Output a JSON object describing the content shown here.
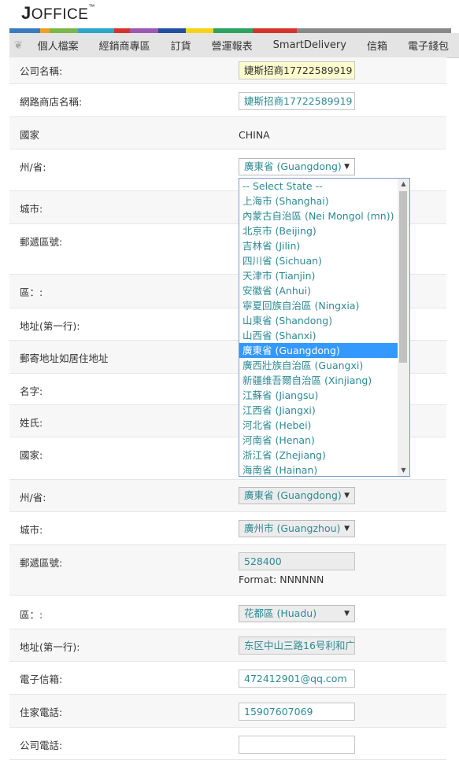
{
  "header": {
    "logo_first": "J",
    "logo_rest": "OFFICE",
    "logo_tm": "™",
    "stripe_colors": [
      "#3a7bbf",
      "#f0a020",
      "#7ab648",
      "#2aa6c9",
      "#d6332a",
      "#9b59b6",
      "#1f4f9e",
      "#f7d21a",
      "#2ca25f",
      "#d6332a",
      "#888888"
    ]
  },
  "nav": {
    "items": [
      "個人檔案",
      "經銷商專區",
      "訂貨",
      "營運報表",
      "SmartDelivery",
      "信箱",
      "電子錢包"
    ]
  },
  "form": {
    "company_name": {
      "label": "公司名稱:",
      "value": "婕斯招商17722589919"
    },
    "shop_name": {
      "label": "網路商店名稱:",
      "value": "婕斯招商17722589919"
    },
    "country": {
      "label": "國家",
      "value": "CHINA"
    },
    "state": {
      "label": "州/省:",
      "value": "廣東省 (Guangdong)"
    },
    "city": {
      "label": "城市:"
    },
    "postal": {
      "label": "郵遞區號:"
    },
    "district": {
      "label": "區：:"
    },
    "address1": {
      "label": "地址(第一行):"
    },
    "mailing": {
      "label": "郵寄地址如居住地址"
    },
    "first_name": {
      "label": "名字:"
    },
    "last_name": {
      "label": "姓氏:"
    },
    "country2": {
      "label": "國家:"
    },
    "state2": {
      "label": "州/省:",
      "value": "廣東省 (Guangdong)"
    },
    "city2": {
      "label": "城市:",
      "value": "廣州市 (Guangzhou)"
    },
    "postal2": {
      "label": "郵遞區號:",
      "value": "528400",
      "hint": "Format: NNNNNN"
    },
    "district2": {
      "label": "區：:",
      "value": "花都區 (Huadu)"
    },
    "address1_2": {
      "label": "地址(第一行):",
      "value": "东区中山三路16号利和广"
    },
    "email": {
      "label": "電子信箱:",
      "value": "472412901@qq.com"
    },
    "home_phone": {
      "label": "住家電話:",
      "value": "15907607069"
    },
    "company_phone": {
      "label": "公司電話:",
      "value": ""
    }
  },
  "dropdown": {
    "options": [
      "-- Select State --",
      "上海市 (Shanghai)",
      "內蒙古自治區 (Nei Mongol (mn))",
      "北京市 (Beijing)",
      "吉林省 (Jilin)",
      "四川省 (Sichuan)",
      "天津市 (Tianjin)",
      "安徽省 (Anhui)",
      "寧夏回族自治區 (Ningxia)",
      "山東省 (Shandong)",
      "山西省 (Shanxi)",
      "廣東省 (Guangdong)",
      "廣西壯族自治區 (Guangxi)",
      "新疆维吾爾自治區 (Xinjiang)",
      "江蘇省 (Jiangsu)",
      "江西省 (Jiangxi)",
      "河北省 (Hebei)",
      "河南省 (Henan)",
      "浙江省 (Zhejiang)",
      "海南省 (Hainan)"
    ],
    "selected": "廣東省 (Guangdong)"
  },
  "icons": {
    "select_arrow": "▼",
    "scroll_up": "▲",
    "scroll_down": "▼",
    "nav_leaf": "❦"
  }
}
